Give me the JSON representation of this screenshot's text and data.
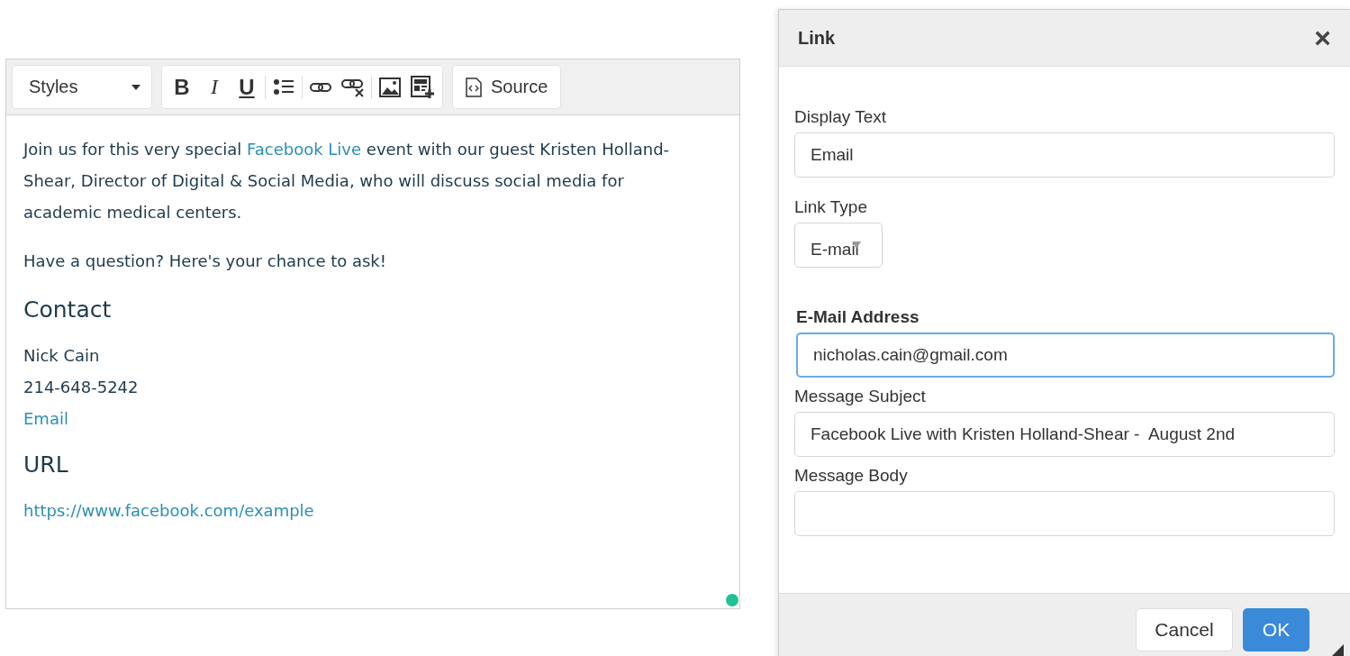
{
  "editor": {
    "toolbar": {
      "styles": {
        "label": "Styles"
      },
      "format_buttons": [
        {
          "kind": "bold",
          "glyph": "B"
        },
        {
          "kind": "italic",
          "glyph": "I"
        },
        {
          "kind": "underline",
          "glyph": "U"
        }
      ],
      "tool_buttons": [
        {
          "kind": "bulleted-list"
        },
        {
          "kind": "link"
        },
        {
          "kind": "unlink"
        },
        {
          "kind": "image"
        },
        {
          "kind": "insert-template"
        }
      ],
      "source": {
        "label": "Source"
      }
    },
    "content": [
      {
        "kind": "paragraph",
        "segments": [
          {
            "kind": "text",
            "text": "Join us for this very special "
          },
          {
            "kind": "link",
            "text": "Facebook Live"
          },
          {
            "kind": "text",
            "text": " event with our guest Kristen Holland-Shear, Director of Digital & Social Media, who will discuss social media for academic medical centers."
          }
        ]
      },
      {
        "kind": "paragraph",
        "segments": [
          {
            "kind": "text",
            "text": "Have a question? Here's your chance to ask!"
          }
        ]
      },
      {
        "kind": "heading",
        "text": "Contact"
      },
      {
        "kind": "lines",
        "lines": [
          {
            "text": "Nick Cain",
            "link": false
          },
          {
            "text": "214-648-5242",
            "link": false
          },
          {
            "text": "Email",
            "link": true
          }
        ]
      },
      {
        "kind": "heading",
        "text": "URL"
      },
      {
        "kind": "lines",
        "lines": [
          {
            "text": "https://www.facebook.com/example",
            "link": true
          }
        ]
      }
    ]
  },
  "dialog": {
    "title": "Link",
    "close": "×",
    "fields": [
      {
        "kind": "text",
        "label": "Display Text",
        "value": "Email",
        "required": false
      },
      {
        "kind": "select",
        "label": "Link Type",
        "value": "E-mail",
        "required": false
      },
      {
        "kind": "text",
        "label": "E-Mail Address",
        "value": "nicholas.cain@gmail.com",
        "required": true,
        "focused": true
      },
      {
        "kind": "text",
        "label": "Message Subject",
        "value": "Facebook Live with Kristen Holland-Shear -  August 2nd",
        "required": false
      },
      {
        "kind": "text",
        "label": "Message Body",
        "required": false
      }
    ],
    "buttons": [
      {
        "kind": "secondary",
        "label": "Cancel"
      },
      {
        "kind": "primary",
        "label": "OK"
      }
    ]
  }
}
